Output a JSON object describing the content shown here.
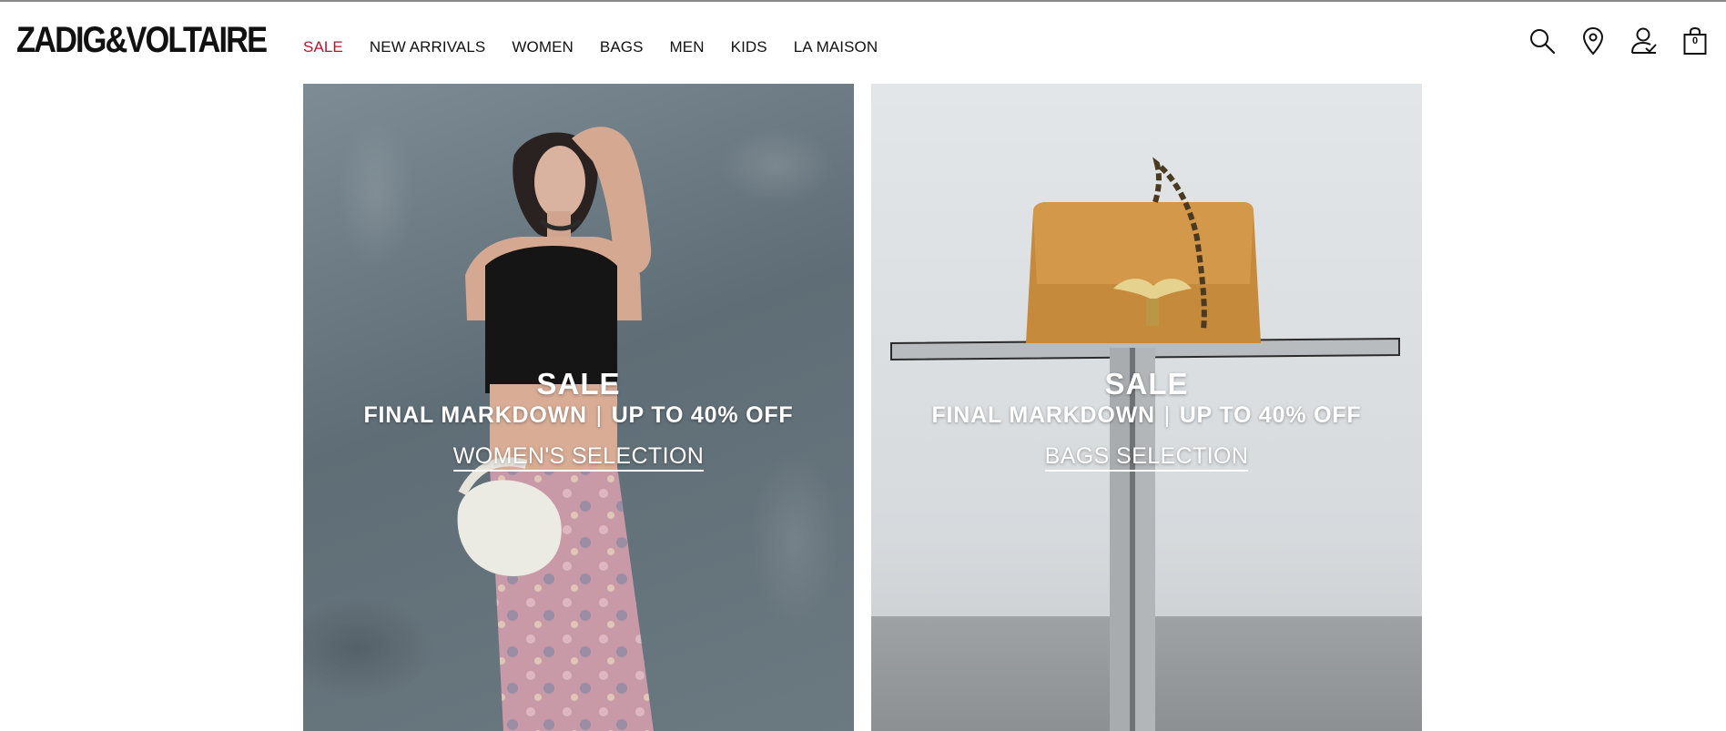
{
  "brand": {
    "logo_text": "ZADIG&VOLTAIRE"
  },
  "nav": {
    "items": [
      {
        "label": "SALE",
        "accent": "#b5162b"
      },
      {
        "label": "NEW ARRIVALS"
      },
      {
        "label": "WOMEN"
      },
      {
        "label": "BAGS"
      },
      {
        "label": "MEN"
      },
      {
        "label": "KIDS"
      },
      {
        "label": "LA MAISON"
      }
    ]
  },
  "header_icons": {
    "search": "search-icon",
    "store": "location-pin-icon",
    "account": "account-icon",
    "bag": "shopping-bag-icon",
    "bag_count": "0"
  },
  "tiles": [
    {
      "title": "SALE",
      "sub_left": "FINAL MARKDOWN",
      "sub_sep": "|",
      "sub_right": "UP TO 40% OFF",
      "cta": "WOMEN'S SELECTION"
    },
    {
      "title": "SALE",
      "sub_left": "FINAL MARKDOWN",
      "sub_sep": "|",
      "sub_right": "UP TO 40% OFF",
      "cta": "BAGS SELECTION"
    }
  ]
}
